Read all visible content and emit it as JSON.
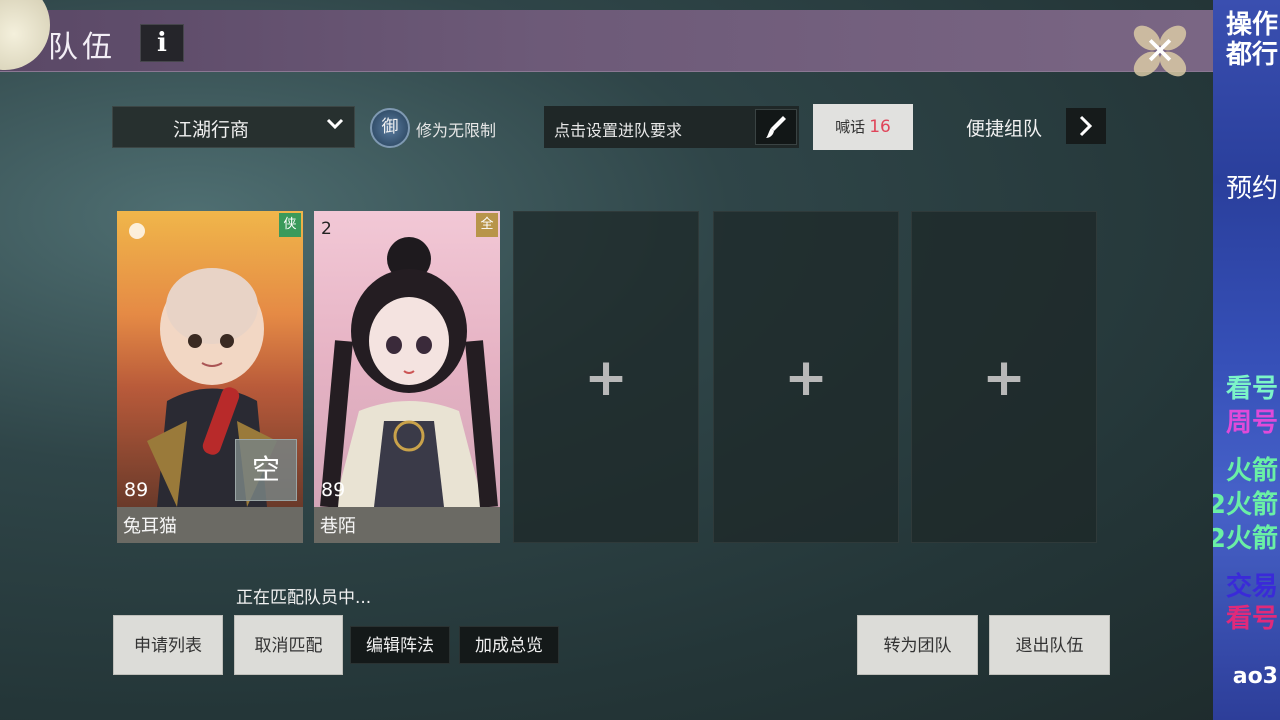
{
  "header": {
    "title": "队伍",
    "info_icon_label": "i",
    "close_icon": "close-icon"
  },
  "controls": {
    "team_mode": "江湖行商",
    "rank_icon_char": "御",
    "rank_requirement": "修为无限制",
    "requirement_prompt": "点击设置进队要求",
    "shout_label": "喊话",
    "shout_count": "16",
    "quick_team_label": "便捷组队"
  },
  "members": [
    {
      "name": "兔耳猫",
      "level": "89",
      "badge": "侠",
      "badge_color": "#3a9a5b",
      "tag": "空"
    },
    {
      "name": "巷陌",
      "level": "89",
      "badge": "全",
      "badge_color": "#b8954a",
      "seat": "2"
    }
  ],
  "empty_slots": [
    "+",
    "+",
    "+"
  ],
  "status": {
    "matching_text": "正在匹配队员中..."
  },
  "actions": {
    "apply_list": "申请列表",
    "cancel_match": "取消匹配",
    "edit_formation": "编辑阵法",
    "bonus_overview": "加成总览",
    "convert_team": "转为团队",
    "leave_team": "退出队伍"
  },
  "stream_overlay": {
    "lines": [
      "操作",
      "都行",
      "预约",
      "看号",
      "周号",
      "火箭",
      "2火箭",
      "2火箭",
      "交易",
      "看号",
      "ao3"
    ]
  }
}
